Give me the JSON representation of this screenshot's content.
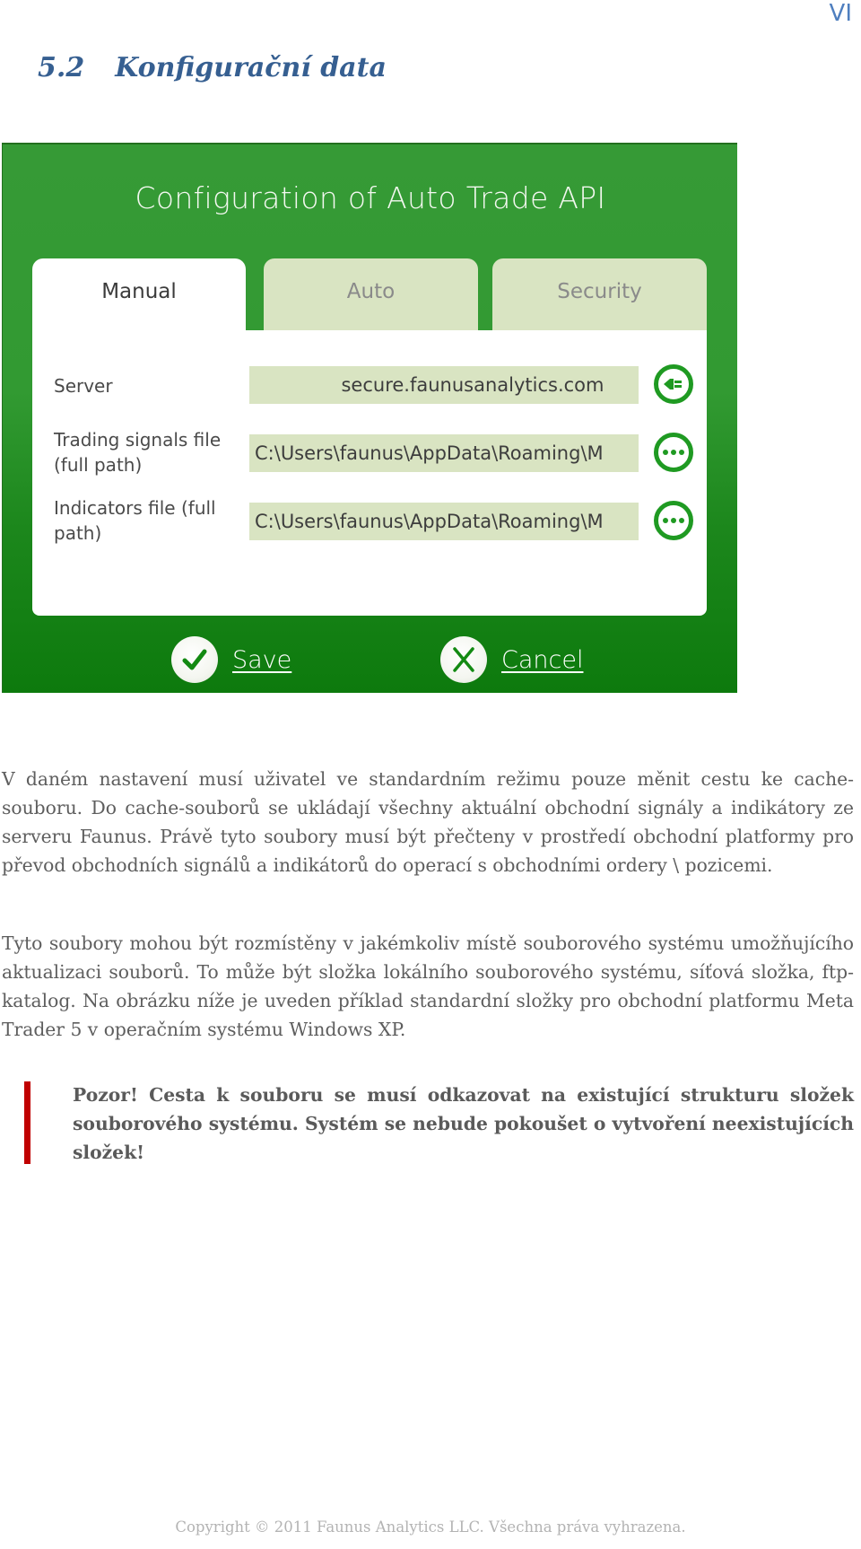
{
  "page": {
    "page_number": "VI",
    "section_number": "5.2",
    "section_title": "Konfigurační data"
  },
  "dialog": {
    "title": "Configuration of Auto Trade API",
    "tabs": [
      {
        "label": "Manual",
        "active": true
      },
      {
        "label": "Auto",
        "active": false
      },
      {
        "label": "Security",
        "active": false
      }
    ],
    "fields": [
      {
        "label": "Server",
        "value": "secure.faunusanalytics.com",
        "action_icon": "plug-icon"
      },
      {
        "label": "Trading signals file (full path)",
        "value": "C:\\Users\\faunus\\AppData\\Roaming\\M",
        "action_icon": "more-icon"
      },
      {
        "label": "Indicators file (full path)",
        "value": "C:\\Users\\faunus\\AppData\\Roaming\\M",
        "action_icon": "more-icon"
      }
    ],
    "save_label": "Save",
    "cancel_label": "Cancel",
    "colors": {
      "frame_green": "#329a32",
      "frame_green_dark": "#0d7a0d",
      "tab_inactive": "#d9e4c2",
      "input_bg": "#d9e4c2",
      "icon_green": "#1f9a22"
    }
  },
  "body": {
    "paragraph1": "V daném nastavení musí uživatel ve standardním režimu pouze měnit cestu ke cache-souboru. Do cache-souborů se ukládají všechny aktuální obchodní signály a indikátory ze serveru Faunus. Právě tyto soubory musí být přečteny v prostředí obchodní platformy pro převod obchodních signálů a indikátorů do operací s obchodními ordery \\ pozicemi.",
    "paragraph2": "Tyto soubory mohou být rozmístěny v jakémkoliv místě souborového systému umožňujícího aktualizaci souborů. To může být složka lokálního souborového systému, síťová složka, ftp-katalog. Na obrázku níže je uveden příklad standardní složky pro obchodní platformu Meta Trader 5 v operačním systému Windows XP.",
    "warning": "Pozor! Cesta k souboru se musí odkazovat na existující strukturu složek souborového systému. Systém se nebude pokoušet o vytvoření neexistujících složek!",
    "warning_color": "#c00000"
  },
  "footer": {
    "copyright": "Copyright © 2011 Faunus Analytics LLC. Všechna práva vyhrazena."
  }
}
